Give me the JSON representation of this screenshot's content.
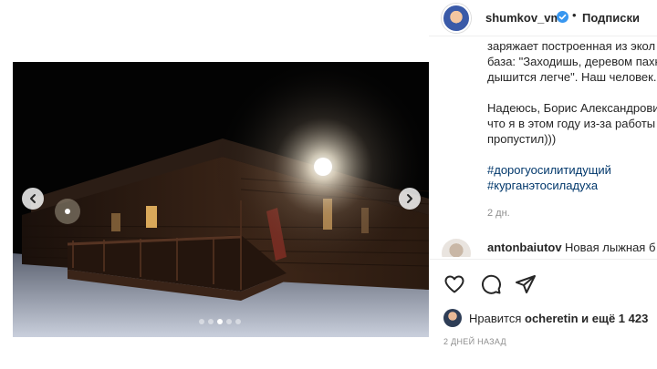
{
  "header": {
    "username": "shumkov_vm",
    "separator": "•",
    "follow_label": "Подписки"
  },
  "caption": {
    "lines": [
      "заряжает построенная из экол",
      "база: \"Заходишь, деревом пахн",
      "дышится легче\". Наш человек.",
      "",
      "Надеюсь, Борис Александрови",
      "что я в этом году из-за работы",
      "пропустил)))"
    ],
    "hashtags": [
      "#дорогуосилитидущий",
      "#курганэтосиладуха"
    ],
    "time": "2 дн."
  },
  "comment": {
    "user": "antonbaiutov",
    "text": "Новая лыжная б"
  },
  "likes": {
    "prefix": "Нравится",
    "user": "ocheretin",
    "suffix": "и ещё 1 423"
  },
  "date": "2 ДНЕЙ НАЗАД",
  "carousel": {
    "slides": 5,
    "active_index": 2
  },
  "icons": {
    "prev": "chevron-left-icon",
    "next": "chevron-right-icon",
    "like": "heart-icon",
    "comment": "comment-icon",
    "share": "paper-plane-icon",
    "verified": "verified-badge-icon"
  },
  "colors": {
    "verified": "#3897f0",
    "hashtag": "#00376b",
    "muted": "#8e8e8e",
    "text": "#262626"
  }
}
